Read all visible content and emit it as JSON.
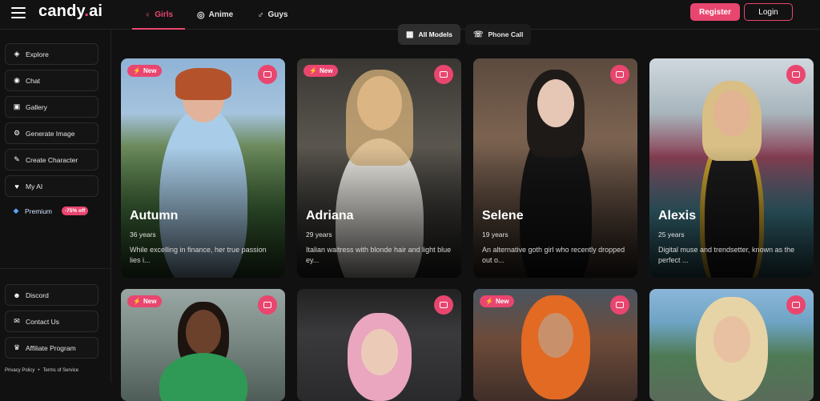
{
  "header": {
    "logo_text": "candy",
    "logo_dot": ".",
    "logo_suffix": "ai",
    "tabs": [
      {
        "label": "Girls",
        "icon": "female-icon",
        "active": true
      },
      {
        "label": "Anime",
        "icon": "anime-icon",
        "active": false
      },
      {
        "label": "Guys",
        "icon": "male-icon",
        "active": false
      }
    ],
    "register_label": "Register",
    "login_label": "Login"
  },
  "sidebar": {
    "items": [
      {
        "label": "Explore",
        "icon": "compass-icon"
      },
      {
        "label": "Chat",
        "icon": "chat-icon"
      },
      {
        "label": "Gallery",
        "icon": "gallery-icon"
      },
      {
        "label": "Generate Image",
        "icon": "generate-image-icon"
      },
      {
        "label": "Create Character",
        "icon": "magic-wand-icon"
      },
      {
        "label": "My AI",
        "icon": "my-ai-icon"
      },
      {
        "label": "Premium",
        "icon": "diamond-icon",
        "badge": "-75% off"
      }
    ],
    "bottom_items": [
      {
        "label": "Discord",
        "icon": "discord-icon"
      },
      {
        "label": "Contact Us",
        "icon": "contact-icon"
      },
      {
        "label": "Affiliate Program",
        "icon": "trophy-icon"
      }
    ],
    "footer": {
      "privacy": "Privacy Policy",
      "separator": "•",
      "terms": "Terms of Service"
    }
  },
  "filters": [
    {
      "label": "All Models",
      "icon": "grid-icon",
      "active": true
    },
    {
      "label": "Phone Call",
      "icon": "phone-icon",
      "active": false
    }
  ],
  "cards": [
    {
      "name": "Autumn",
      "age": "36 years",
      "desc": "While excelling in finance, her true passion lies i...",
      "is_new": true
    },
    {
      "name": "Adriana",
      "age": "29 years",
      "desc": "Italian waitress with blonde hair and light blue ey...",
      "is_new": true
    },
    {
      "name": "Selene",
      "age": "19 years",
      "desc": "An alternative goth girl who recently dropped out o...",
      "is_new": false
    },
    {
      "name": "Alexis",
      "age": "25 years",
      "desc": "Digital muse and trendsetter, known as the perfect ...",
      "is_new": false
    },
    {
      "is_new": true
    },
    {
      "is_new": false
    },
    {
      "is_new": true
    },
    {
      "is_new": false
    }
  ],
  "new_badge_label": "New",
  "colors": {
    "accent": "#e9466f",
    "background": "#111111",
    "premium_icon": "#5aa7ff"
  }
}
